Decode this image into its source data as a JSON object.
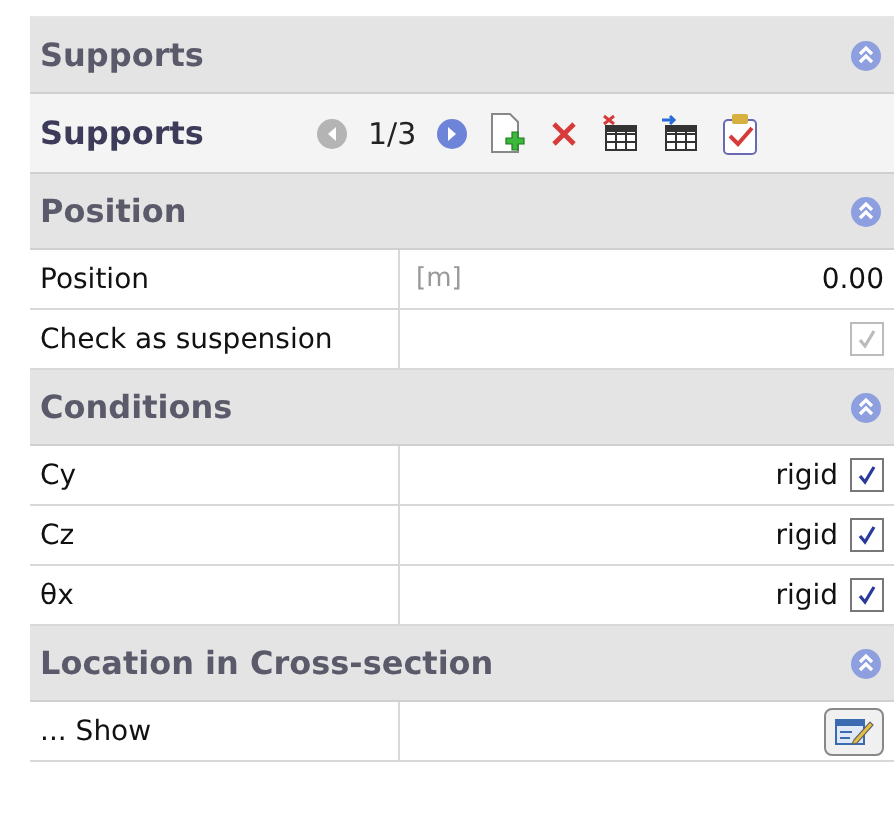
{
  "sections": [
    {
      "title": "Supports",
      "expanded": true,
      "toolbar": {
        "label": "Supports",
        "counter": "1/3",
        "prev_disabled": true,
        "next_disabled": false
      }
    },
    {
      "title": "Position",
      "expanded": true,
      "rows": [
        {
          "kind": "value",
          "label": "Position",
          "unit": "[m]",
          "value": "0.00"
        },
        {
          "kind": "checkbox",
          "label": "Check as suspension",
          "checked": true,
          "disabled": true
        }
      ]
    },
    {
      "title": "Conditions",
      "expanded": true,
      "rows": [
        {
          "kind": "checkbox",
          "label": "Cy",
          "value": "rigid",
          "checked": true,
          "disabled": false
        },
        {
          "kind": "checkbox",
          "label": "Cz",
          "value": "rigid",
          "checked": true,
          "disabled": false
        },
        {
          "kind": "checkbox",
          "label": "θx",
          "value": "rigid",
          "checked": true,
          "disabled": false
        }
      ]
    },
    {
      "title": "Location in Cross-section",
      "expanded": true,
      "rows": [
        {
          "kind": "button",
          "label": "... Show"
        }
      ]
    }
  ]
}
